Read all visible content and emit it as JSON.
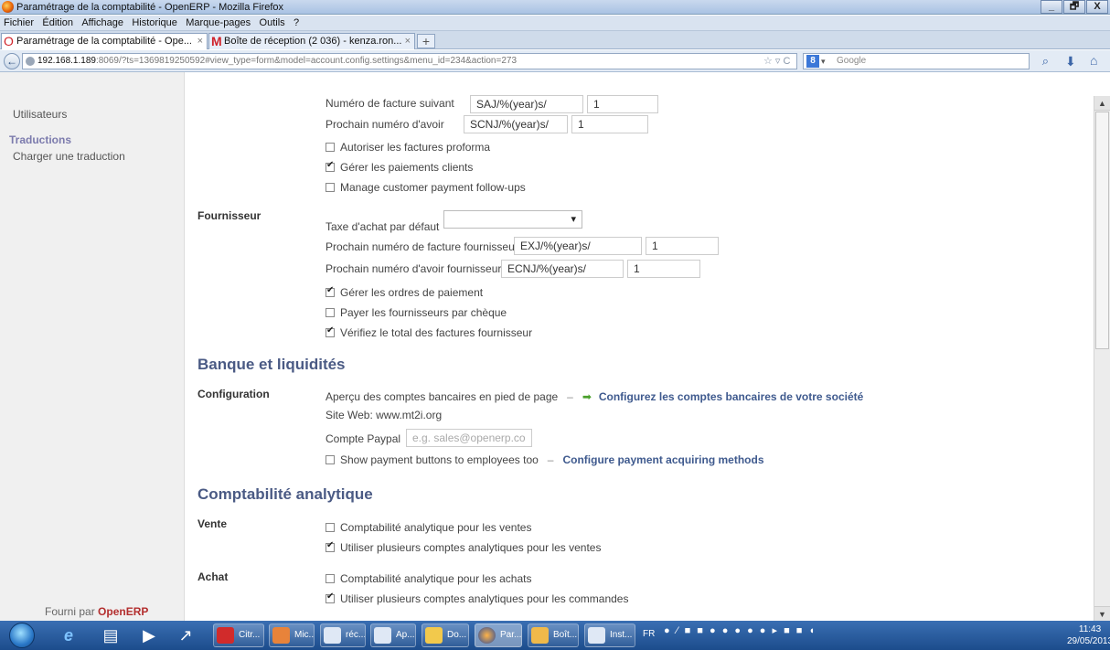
{
  "window": {
    "title": "Paramétrage de la comptabilité - OpenERP - Mozilla Firefox",
    "buttons": [
      "_",
      "🗗",
      "X"
    ]
  },
  "menubar": [
    "Fichier",
    "Édition",
    "Affichage",
    "Historique",
    "Marque-pages",
    "Outils",
    "?"
  ],
  "tabs": [
    {
      "label": "Paramétrage de la comptabilité - Ope...",
      "close": "×",
      "icon": "O"
    },
    {
      "label": "Boîte de réception (2 036) - kenza.ron...",
      "close": "×",
      "icon": "M"
    }
  ],
  "newtab": "+",
  "nav": {
    "back": "←",
    "url_host": "192.168.1.189",
    "url_rest": ":8069/?ts=1369819250592#view_type=form&model=account.config.settings&menu_id=234&action=273",
    "url_tools": "☆ ▿ C",
    "search_engine": "Google",
    "search_logo": "8",
    "search_drop": "▾",
    "magnifier": "⌕",
    "download": "⬇",
    "home": "⌂"
  },
  "sidebar": {
    "items": [
      "Utilisateurs",
      "Charger une traduction"
    ],
    "heading": "Traductions",
    "footer_prefix": "Fourni par",
    "footer_brand": "OpenERP"
  },
  "form": {
    "client": {
      "next_invoice_label": "Numéro de facture suivant",
      "next_invoice_value": "SAJ/%(year)s/",
      "next_invoice_num": "1",
      "next_refund_label": "Prochain numéro d'avoir",
      "next_refund_value": "SCNJ/%(year)s/",
      "next_refund_num": "1",
      "checkboxes": [
        {
          "label": "Autoriser les factures proforma",
          "checked": false
        },
        {
          "label": "Gérer les paiements clients",
          "checked": true
        },
        {
          "label": "Manage customer payment follow-ups",
          "checked": false
        }
      ]
    },
    "supplier": {
      "group": "Fournisseur",
      "tax_label": "Taxe d'achat par défaut",
      "tax_value": "▾",
      "invoice_label": "Prochain numéro de facture fournisseur",
      "invoice_value": "EXJ/%(year)s/",
      "invoice_num": "1",
      "refund_label": "Prochain numéro d'avoir fournisseur",
      "refund_value": "ECNJ/%(year)s/",
      "refund_num": "1",
      "checkboxes": [
        {
          "label": "Gérer les ordres de paiement",
          "checked": true
        },
        {
          "label": "Payer les fournisseurs par chèque",
          "checked": false
        },
        {
          "label": "Vérifiez le total des factures fournisseur",
          "checked": true
        }
      ]
    },
    "bank": {
      "title": "Banque et liquidités",
      "group": "Configuration",
      "accounts_label": "Aperçu des comptes bancaires en pied de page",
      "dash": "–",
      "accounts_link": "Configurez les comptes bancaires de votre société",
      "website": "Site Web: www.mt2i.org",
      "paypal_label": "Compte Paypal",
      "paypal_placeholder": "e.g. sales@openerp.co",
      "show_buttons_label": "Show payment buttons to employees too",
      "show_buttons_checked": false,
      "acquirer_link": "Configure payment acquiring methods"
    },
    "analytic": {
      "title": "Comptabilité analytique",
      "sale_group": "Vente",
      "sale_checkboxes": [
        {
          "label": "Comptabilité analytique pour les ventes",
          "checked": false
        },
        {
          "label": "Utiliser plusieurs comptes analytiques pour les ventes",
          "checked": true
        }
      ],
      "purchase_group": "Achat",
      "purchase_checkboxes": [
        {
          "label": "Comptabilité analytique pour les achats",
          "checked": false
        },
        {
          "label": "Utiliser plusieurs comptes analytiques pour les commandes",
          "checked": true
        }
      ]
    }
  },
  "scroll": {
    "up": "▲",
    "down": "▼"
  },
  "taskbar": {
    "tasks": [
      "Citr...",
      "Mic...",
      "réc...",
      "Ap...",
      "Do...",
      "Par...",
      "Boît...",
      "Inst..."
    ],
    "lang": "FR",
    "tray": "● ⁄ ■ ■ ● ● ● ● ● ▸ ■ ■ ◖",
    "time": "11:43",
    "date": "29/05/2013"
  },
  "colors": {
    "accent": "#4a5a84",
    "link": "#3f5a8e",
    "brand": "#b32e2e"
  }
}
